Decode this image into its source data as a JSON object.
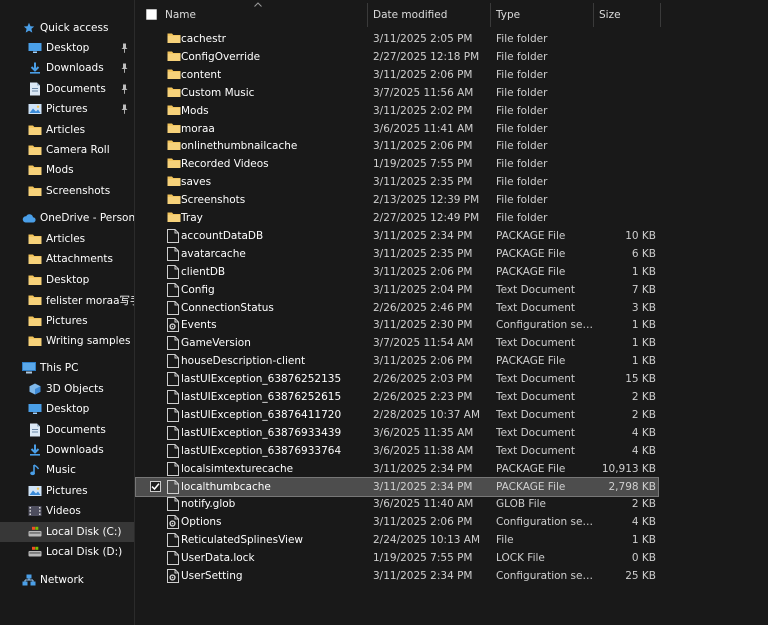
{
  "sidebar": {
    "items": [
      {
        "label": "Quick access",
        "icon": "star-icon",
        "level": 0,
        "pinned": false
      },
      {
        "label": "Desktop",
        "icon": "desktop-icon",
        "level": 1,
        "pinned": true
      },
      {
        "label": "Downloads",
        "icon": "download-icon",
        "level": 1,
        "pinned": true
      },
      {
        "label": "Documents",
        "icon": "documents-icon",
        "level": 1,
        "pinned": true
      },
      {
        "label": "Pictures",
        "icon": "pictures-icon",
        "level": 1,
        "pinned": true
      },
      {
        "label": "Articles",
        "icon": "folder-icon",
        "level": 1,
        "pinned": false
      },
      {
        "label": "Camera Roll",
        "icon": "folder-icon",
        "level": 1,
        "pinned": false
      },
      {
        "label": "Mods",
        "icon": "folder-icon",
        "level": 1,
        "pinned": false
      },
      {
        "label": "Screenshots",
        "icon": "folder-icon",
        "level": 1,
        "pinned": false
      },
      {
        "label": "OneDrive - Personal",
        "icon": "cloud-icon",
        "level": 0,
        "pinned": false
      },
      {
        "label": "Articles",
        "icon": "folder-icon",
        "level": 1,
        "pinned": false
      },
      {
        "label": "Attachments",
        "icon": "folder-icon",
        "level": 1,
        "pinned": false
      },
      {
        "label": "Desktop",
        "icon": "folder-icon",
        "level": 1,
        "pinned": false
      },
      {
        "label": "felister moraa写手邦",
        "icon": "folder-icon",
        "level": 1,
        "pinned": false
      },
      {
        "label": "Pictures",
        "icon": "folder-icon",
        "level": 1,
        "pinned": false
      },
      {
        "label": "Writing samples",
        "icon": "folder-icon",
        "level": 1,
        "pinned": false
      },
      {
        "label": "This PC",
        "icon": "computer-icon",
        "level": 0,
        "pinned": false
      },
      {
        "label": "3D Objects",
        "icon": "cube-icon",
        "level": 1,
        "pinned": false
      },
      {
        "label": "Desktop",
        "icon": "desktop-icon",
        "level": 1,
        "pinned": false
      },
      {
        "label": "Documents",
        "icon": "documents-icon",
        "level": 1,
        "pinned": false
      },
      {
        "label": "Downloads",
        "icon": "download-icon",
        "level": 1,
        "pinned": false
      },
      {
        "label": "Music",
        "icon": "music-icon",
        "level": 1,
        "pinned": false
      },
      {
        "label": "Pictures",
        "icon": "pictures-icon",
        "level": 1,
        "pinned": false
      },
      {
        "label": "Videos",
        "icon": "videos-icon",
        "level": 1,
        "pinned": false
      },
      {
        "label": "Local Disk (C:)",
        "icon": "drive-icon",
        "level": 1,
        "pinned": false,
        "selected": true
      },
      {
        "label": "Local Disk (D:)",
        "icon": "drive-icon",
        "level": 1,
        "pinned": false
      },
      {
        "label": "Network",
        "icon": "network-icon",
        "level": 0,
        "pinned": false
      }
    ]
  },
  "columns": {
    "name": "Name",
    "date": "Date modified",
    "type": "Type",
    "size": "Size"
  },
  "files": [
    {
      "name": "cachestr",
      "date": "3/11/2025 2:05 PM",
      "type": "File folder",
      "size": "",
      "kind": "folder"
    },
    {
      "name": "ConfigOverride",
      "date": "2/27/2025 12:18 PM",
      "type": "File folder",
      "size": "",
      "kind": "folder"
    },
    {
      "name": "content",
      "date": "3/11/2025 2:06 PM",
      "type": "File folder",
      "size": "",
      "kind": "folder"
    },
    {
      "name": "Custom Music",
      "date": "3/7/2025 11:56 AM",
      "type": "File folder",
      "size": "",
      "kind": "folder"
    },
    {
      "name": "Mods",
      "date": "3/11/2025 2:02 PM",
      "type": "File folder",
      "size": "",
      "kind": "folder"
    },
    {
      "name": "moraa",
      "date": "3/6/2025 11:41 AM",
      "type": "File folder",
      "size": "",
      "kind": "folder"
    },
    {
      "name": "onlinethumbnailcache",
      "date": "3/11/2025 2:06 PM",
      "type": "File folder",
      "size": "",
      "kind": "folder"
    },
    {
      "name": "Recorded Videos",
      "date": "1/19/2025 7:55 PM",
      "type": "File folder",
      "size": "",
      "kind": "folder"
    },
    {
      "name": "saves",
      "date": "3/11/2025 2:35 PM",
      "type": "File folder",
      "size": "",
      "kind": "folder"
    },
    {
      "name": "Screenshots",
      "date": "2/13/2025 12:39 PM",
      "type": "File folder",
      "size": "",
      "kind": "folder"
    },
    {
      "name": "Tray",
      "date": "2/27/2025 12:49 PM",
      "type": "File folder",
      "size": "",
      "kind": "folder"
    },
    {
      "name": "accountDataDB",
      "date": "3/11/2025 2:34 PM",
      "type": "PACKAGE File",
      "size": "10 KB",
      "kind": "file"
    },
    {
      "name": "avatarcache",
      "date": "3/11/2025 2:35 PM",
      "type": "PACKAGE File",
      "size": "6 KB",
      "kind": "file"
    },
    {
      "name": "clientDB",
      "date": "3/11/2025 2:06 PM",
      "type": "PACKAGE File",
      "size": "1 KB",
      "kind": "file"
    },
    {
      "name": "Config",
      "date": "3/11/2025 2:04 PM",
      "type": "Text Document",
      "size": "7 KB",
      "kind": "file"
    },
    {
      "name": "ConnectionStatus",
      "date": "2/26/2025 2:46 PM",
      "type": "Text Document",
      "size": "3 KB",
      "kind": "file"
    },
    {
      "name": "Events",
      "date": "3/11/2025 2:30 PM",
      "type": "Configuration sett...",
      "size": "1 KB",
      "kind": "config"
    },
    {
      "name": "GameVersion",
      "date": "3/7/2025 11:54 AM",
      "type": "Text Document",
      "size": "1 KB",
      "kind": "file"
    },
    {
      "name": "houseDescription-client",
      "date": "3/11/2025 2:06 PM",
      "type": "PACKAGE File",
      "size": "1 KB",
      "kind": "file"
    },
    {
      "name": "lastUIException_63876252135",
      "date": "2/26/2025 2:03 PM",
      "type": "Text Document",
      "size": "15 KB",
      "kind": "file"
    },
    {
      "name": "lastUIException_63876252615",
      "date": "2/26/2025 2:23 PM",
      "type": "Text Document",
      "size": "2 KB",
      "kind": "file"
    },
    {
      "name": "lastUIException_63876411720",
      "date": "2/28/2025 10:37 AM",
      "type": "Text Document",
      "size": "2 KB",
      "kind": "file"
    },
    {
      "name": "lastUIException_63876933439",
      "date": "3/6/2025 11:35 AM",
      "type": "Text Document",
      "size": "4 KB",
      "kind": "file"
    },
    {
      "name": "lastUIException_63876933764",
      "date": "3/6/2025 11:38 AM",
      "type": "Text Document",
      "size": "4 KB",
      "kind": "file"
    },
    {
      "name": "localsimtexturecache",
      "date": "3/11/2025 2:34 PM",
      "type": "PACKAGE File",
      "size": "10,913 KB",
      "kind": "file"
    },
    {
      "name": "localthumbcache",
      "date": "3/11/2025 2:34 PM",
      "type": "PACKAGE File",
      "size": "2,798 KB",
      "kind": "file",
      "selected": true
    },
    {
      "name": "notify.glob",
      "date": "3/6/2025 11:40 AM",
      "type": "GLOB File",
      "size": "2 KB",
      "kind": "file"
    },
    {
      "name": "Options",
      "date": "3/11/2025 2:06 PM",
      "type": "Configuration sett...",
      "size": "4 KB",
      "kind": "config"
    },
    {
      "name": "ReticulatedSplinesView",
      "date": "2/24/2025 10:13 AM",
      "type": "File",
      "size": "1 KB",
      "kind": "file"
    },
    {
      "name": "UserData.lock",
      "date": "1/19/2025 7:55 PM",
      "type": "LOCK File",
      "size": "0 KB",
      "kind": "file"
    },
    {
      "name": "UserSetting",
      "date": "3/11/2025 2:34 PM",
      "type": "Configuration sett...",
      "size": "25 KB",
      "kind": "config"
    }
  ],
  "colors": {
    "background": "#191919",
    "folder": "#f2c45a",
    "accent_blue": "#4a9fe8",
    "selected_row": "#4d4d4d"
  }
}
